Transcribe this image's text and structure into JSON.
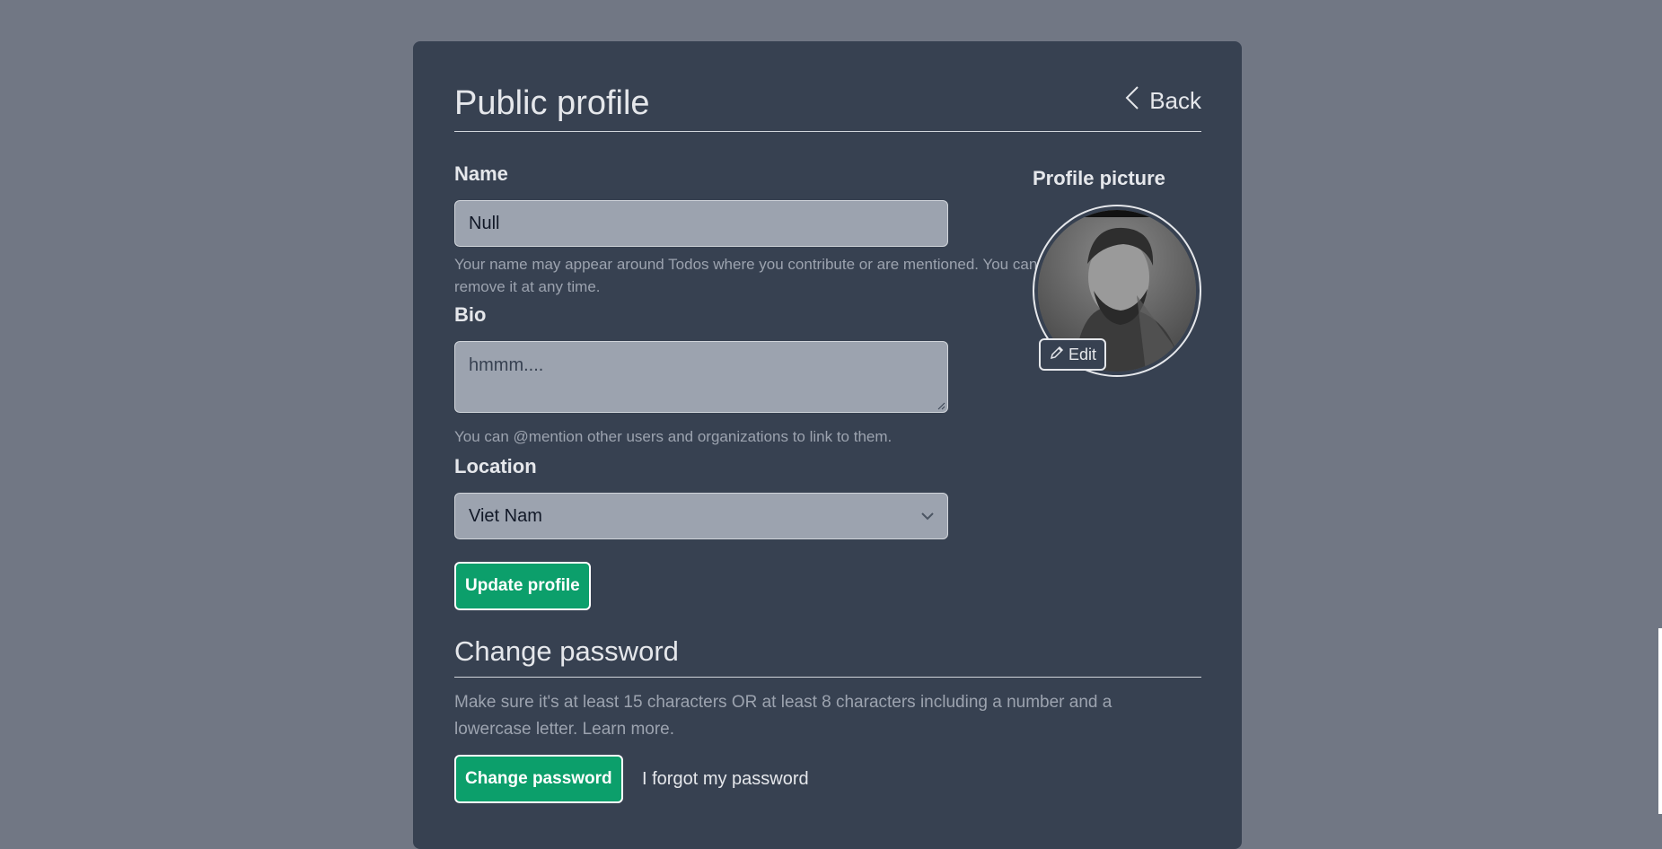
{
  "header": {
    "title": "Public profile",
    "back_label": "Back"
  },
  "name": {
    "label": "Name",
    "value": "Null",
    "help": "Your name may appear around Todos where you contribute or are mentioned. You can remove it at any time."
  },
  "bio": {
    "label": "Bio",
    "placeholder": "hmmm....",
    "help": "You can @mention other users and organizations to link to them."
  },
  "location": {
    "label": "Location",
    "selected": "Viet Nam"
  },
  "update_button": "Update profile",
  "profile_picture": {
    "label": "Profile picture",
    "edit_label": "Edit"
  },
  "password": {
    "title": "Change password",
    "description": "Make sure it's at least 15 characters OR at least 8 characters including a number and a lowercase letter. Learn more.",
    "change_button": "Change password",
    "forgot_link": "I forgot my password"
  },
  "colors": {
    "page_bg": "#717784",
    "card_bg": "#374151",
    "field_bg": "#9ca3af",
    "accent_green": "#0c9f6b"
  },
  "icons": [
    "chevron-left-icon",
    "chevron-down-icon",
    "pencil-icon"
  ]
}
